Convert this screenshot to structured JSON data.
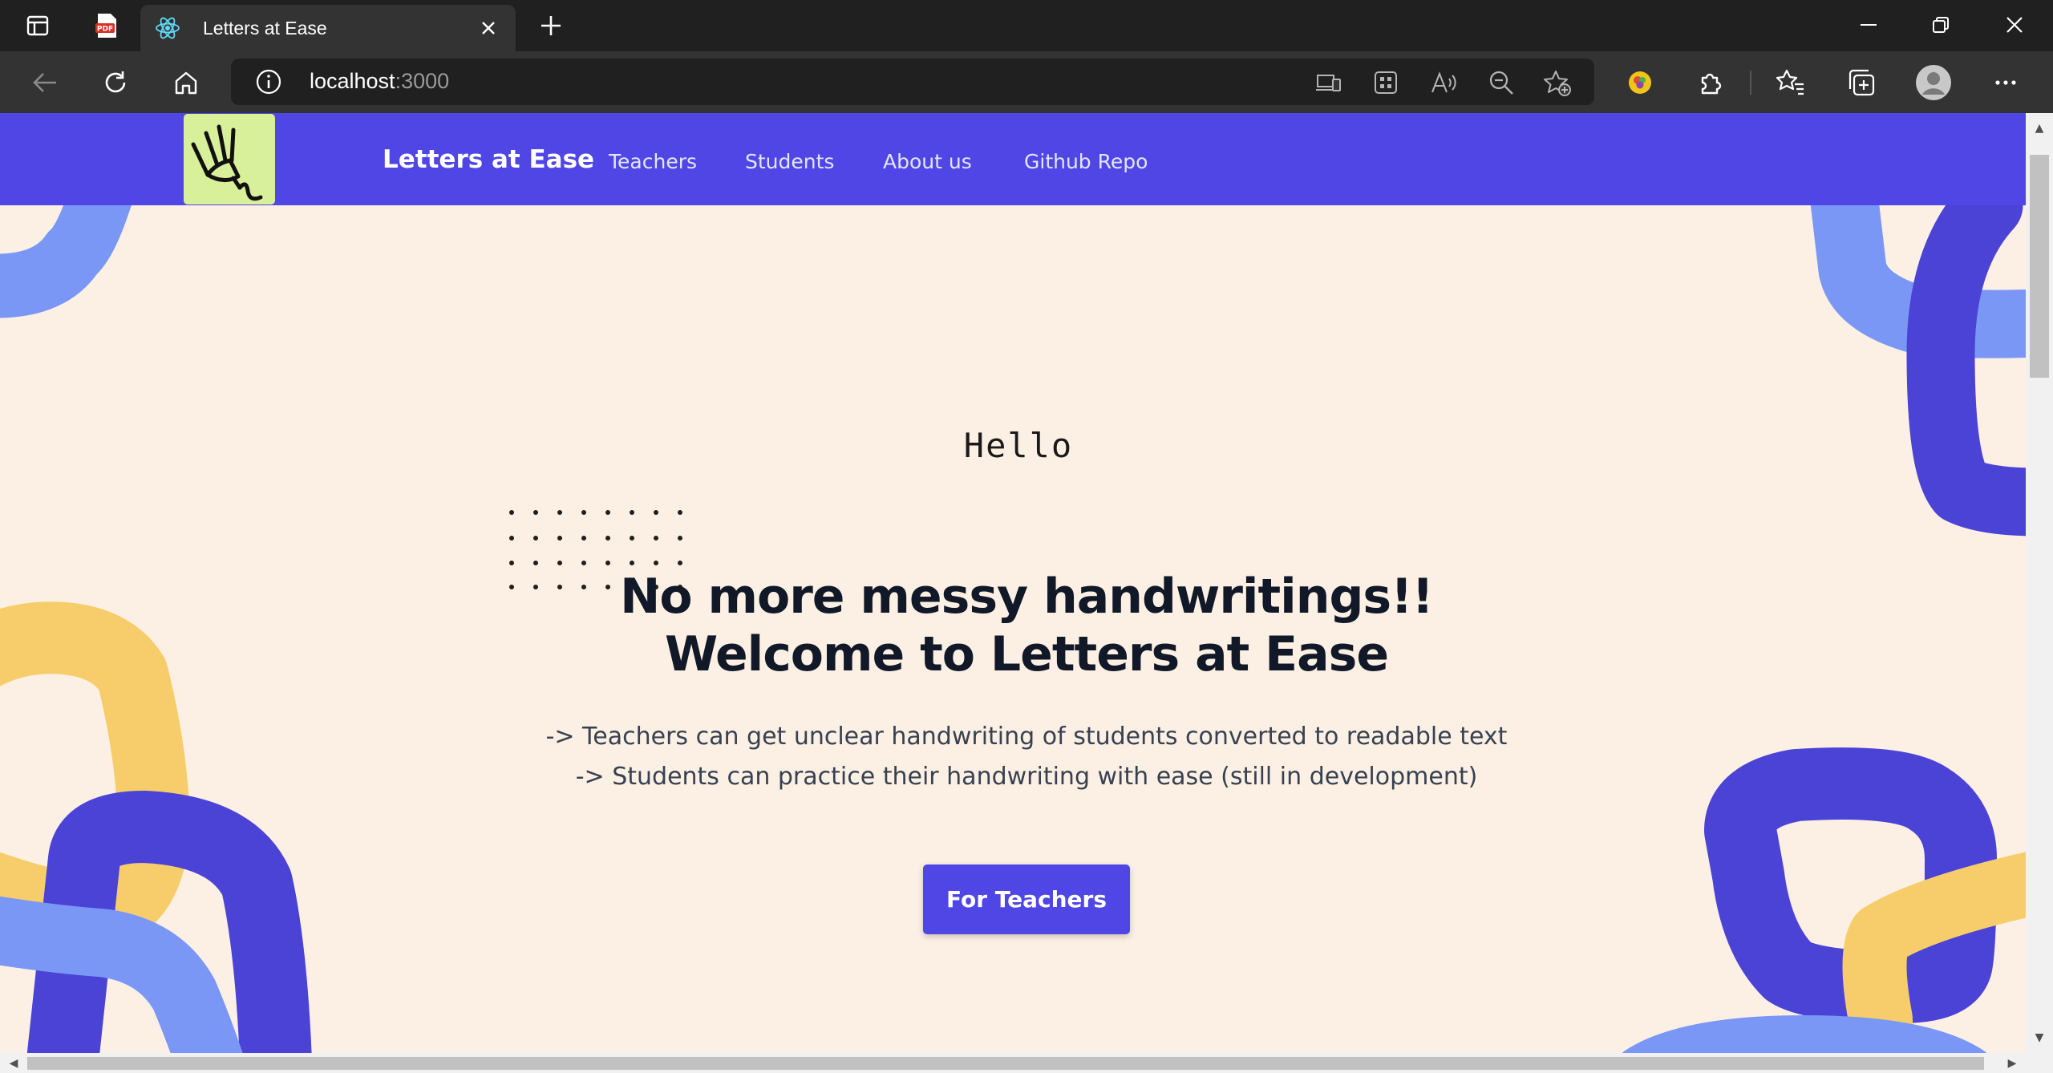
{
  "browser": {
    "tab": {
      "title": "Letters at Ease"
    },
    "address": {
      "host": "localhost",
      "port": ":3000"
    }
  },
  "site": {
    "brand": "Letters at Ease",
    "nav": [
      "Teachers",
      "Students",
      "About us",
      "Github Repo"
    ]
  },
  "hero": {
    "greeting": "Hello",
    "headline_line1": "No more messy handwritings!!",
    "headline_line2": "Welcome to Letters at Ease",
    "point1": "-> Teachers can get unclear handwriting of students converted to readable text",
    "point2": "-> Students can practice their handwriting with ease (still in development)",
    "cta_label": "For Teachers"
  },
  "colors": {
    "accent": "#4f46e5",
    "page_background": "#fcf0e4",
    "logo_background": "#d9f09a",
    "deco_light_blue": "#7b97f5",
    "deco_yellow": "#f6cd6a",
    "deco_dark_blue": "#4b43d6"
  },
  "icons": [
    "tab-actions-icon",
    "pdf-icon",
    "react-icon",
    "close-icon",
    "new-tab-icon",
    "minimize-icon",
    "restore-icon",
    "window-close-icon",
    "back-icon",
    "refresh-icon",
    "home-icon",
    "info-icon",
    "app-available-icon",
    "apps-icon",
    "read-aloud-icon",
    "zoom-out-icon",
    "add-favorite-icon",
    "extension-badge-icon",
    "extensions-icon",
    "favorites-icon",
    "collections-icon",
    "profile-icon",
    "more-icon",
    "pen-hand-logo-icon"
  ]
}
